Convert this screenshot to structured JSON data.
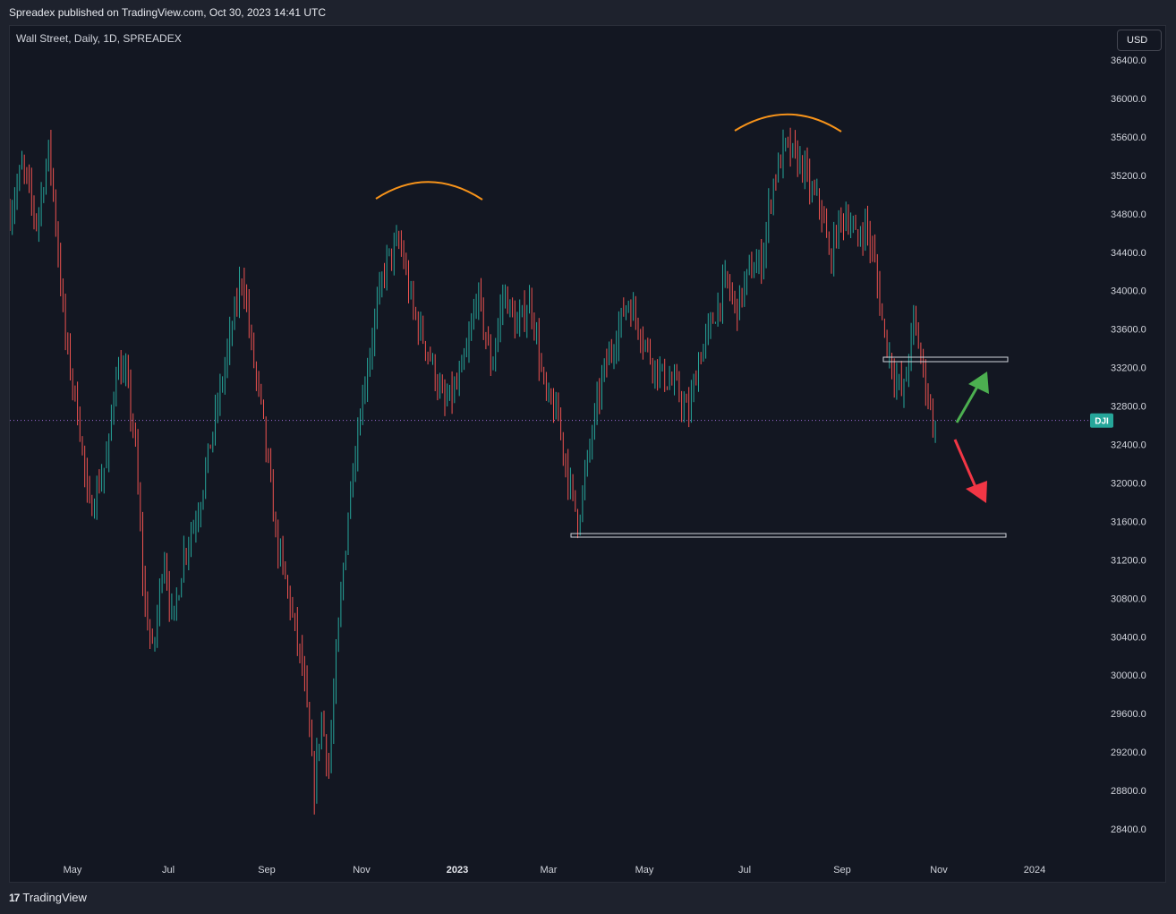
{
  "header": {
    "published": "Spreadex published on TradingView.com, Oct 30, 2023 14:41 UTC"
  },
  "symbol": {
    "title": "Wall Street, Daily, 1D, SPREADEX",
    "currency": "USD",
    "ticker_label": "DJI"
  },
  "footer": {
    "brand": "TradingView"
  },
  "colors": {
    "bull": "#26a69a",
    "bear": "#ef5350",
    "orange": "#f7931a",
    "green_arrow": "#4caf50",
    "red_arrow": "#f23645",
    "price_line": "#9c6ad6"
  },
  "chart_data": {
    "type": "candlestick",
    "title": "",
    "ylim": [
      28150,
      36650
    ],
    "y_ticks": [
      "36400.0",
      "36000.0",
      "35600.0",
      "35200.0",
      "34800.0",
      "34400.0",
      "34000.0",
      "33600.0",
      "33200.0",
      "32800.0",
      "32400.0",
      "32000.0",
      "31600.0",
      "31200.0",
      "30800.0",
      "30400.0",
      "30000.0",
      "29600.0",
      "29200.0",
      "28800.0",
      "28400.0"
    ],
    "x_ticks": [
      {
        "label": "May",
        "pos": 70,
        "year": false
      },
      {
        "label": "Jul",
        "pos": 177,
        "year": false
      },
      {
        "label": "Sep",
        "pos": 287,
        "year": false
      },
      {
        "label": "Nov",
        "pos": 393,
        "year": false
      },
      {
        "label": "2023",
        "pos": 500,
        "year": true
      },
      {
        "label": "Mar",
        "pos": 602,
        "year": false
      },
      {
        "label": "May",
        "pos": 709,
        "year": false
      },
      {
        "label": "Jul",
        "pos": 821,
        "year": false
      },
      {
        "label": "Sep",
        "pos": 930,
        "year": false
      },
      {
        "label": "Nov",
        "pos": 1038,
        "year": false
      },
      {
        "label": "2024",
        "pos": 1145,
        "year": false
      }
    ],
    "last_price": 32650,
    "anchors": [
      [
        0,
        34800
      ],
      [
        14,
        35300
      ],
      [
        30,
        34700
      ],
      [
        44,
        35500
      ],
      [
        62,
        33500
      ],
      [
        78,
        32600
      ],
      [
        88,
        31700
      ],
      [
        100,
        32000
      ],
      [
        110,
        32300
      ],
      [
        118,
        33200
      ],
      [
        130,
        33100
      ],
      [
        140,
        32400
      ],
      [
        150,
        30800
      ],
      [
        160,
        30200
      ],
      [
        172,
        31300
      ],
      [
        182,
        30500
      ],
      [
        195,
        31300
      ],
      [
        210,
        31700
      ],
      [
        230,
        32700
      ],
      [
        250,
        33700
      ],
      [
        260,
        34200
      ],
      [
        270,
        33400
      ],
      [
        282,
        32700
      ],
      [
        298,
        31400
      ],
      [
        312,
        30800
      ],
      [
        328,
        30000
      ],
      [
        340,
        28800
      ],
      [
        348,
        29600
      ],
      [
        356,
        29000
      ],
      [
        368,
        30600
      ],
      [
        382,
        32100
      ],
      [
        394,
        32900
      ],
      [
        408,
        33700
      ],
      [
        420,
        34300
      ],
      [
        436,
        34500
      ],
      [
        450,
        33800
      ],
      [
        470,
        33300
      ],
      [
        485,
        32800
      ],
      [
        500,
        33000
      ],
      [
        512,
        33400
      ],
      [
        522,
        34000
      ],
      [
        538,
        33200
      ],
      [
        552,
        34000
      ],
      [
        566,
        33600
      ],
      [
        582,
        33900
      ],
      [
        598,
        32900
      ],
      [
        612,
        32700
      ],
      [
        625,
        32000
      ],
      [
        635,
        31600
      ],
      [
        650,
        32500
      ],
      [
        662,
        33100
      ],
      [
        676,
        33500
      ],
      [
        690,
        33900
      ],
      [
        700,
        33700
      ],
      [
        716,
        33300
      ],
      [
        730,
        33100
      ],
      [
        744,
        33000
      ],
      [
        758,
        32700
      ],
      [
        770,
        33300
      ],
      [
        786,
        33700
      ],
      [
        800,
        34100
      ],
      [
        812,
        33800
      ],
      [
        826,
        34200
      ],
      [
        840,
        34300
      ],
      [
        852,
        35100
      ],
      [
        866,
        35500
      ],
      [
        876,
        35400
      ],
      [
        886,
        35300
      ],
      [
        896,
        35000
      ],
      [
        906,
        34900
      ],
      [
        916,
        34300
      ],
      [
        926,
        34700
      ],
      [
        936,
        34800
      ],
      [
        946,
        34500
      ],
      [
        956,
        34700
      ],
      [
        966,
        34300
      ],
      [
        976,
        33600
      ],
      [
        986,
        33200
      ],
      [
        998,
        32900
      ],
      [
        1010,
        33700
      ],
      [
        1020,
        33200
      ],
      [
        1030,
        32700
      ],
      [
        1036,
        32500
      ]
    ]
  }
}
